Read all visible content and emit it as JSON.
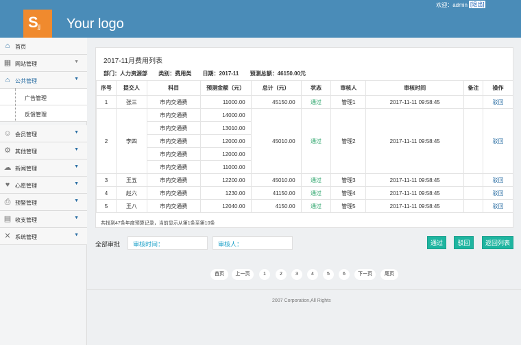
{
  "header": {
    "logo_letter": "S",
    "logo_sub": "jj",
    "logo_text": "Your logo",
    "welcome": "欢迎：admin",
    "logout": "[退出]"
  },
  "sidebar": {
    "items": [
      {
        "label": "首页",
        "icon": "home-icon"
      },
      {
        "label": "网站管理",
        "icon": "grid-icon"
      },
      {
        "label": "公共管理",
        "icon": "home-icon"
      },
      {
        "label": "会员管理",
        "icon": "users-icon"
      },
      {
        "label": "其他管理",
        "icon": "gear-icon"
      },
      {
        "label": "新闻管理",
        "icon": "chat-icon"
      },
      {
        "label": "心愿管理",
        "icon": "heart-icon"
      },
      {
        "label": "预警管理",
        "icon": "printer-icon"
      },
      {
        "label": "收支管理",
        "icon": "card-icon"
      },
      {
        "label": "系统管理",
        "icon": "tools-icon"
      }
    ],
    "subitems": [
      {
        "label": "广告管理"
      },
      {
        "label": "反馈管理"
      }
    ]
  },
  "panel": {
    "title": "2017-11月费用列表",
    "meta": {
      "dept": "部门：人力资源部",
      "category": "类别：费用类",
      "date": "日期：2017-11",
      "total": "预测总额：46150.00元"
    },
    "headers": [
      "序号",
      "提交人",
      "科目",
      "预测金额（元）",
      "总计（元）",
      "状态",
      "审核人",
      "审核时间",
      "备注",
      "操作"
    ],
    "rows": [
      {
        "no": "1",
        "submitter": "张三",
        "subjects": [
          "市内交通费"
        ],
        "amounts": [
          "11000.00"
        ],
        "total": "45150.00",
        "status": "通过",
        "reviewer": "管理1",
        "time": "2017-11-11 09:58:45",
        "note": "",
        "action": "驳回"
      },
      {
        "no": "2",
        "submitter": "李四",
        "subjects": [
          "市内交通费",
          "市内交通费",
          "市内交通费",
          "市内交通费",
          "市内交通费"
        ],
        "amounts": [
          "14000.00",
          "13010.00",
          "12000.00",
          "12000.00",
          "11000.00"
        ],
        "total": "45010.00",
        "status": "通过",
        "reviewer": "管理2",
        "time": "2017-11-11 09:58:45",
        "note": "",
        "action": "驳回"
      },
      {
        "no": "3",
        "submitter": "王五",
        "subjects": [
          "市内交通费"
        ],
        "amounts": [
          "12200.00"
        ],
        "total": "45010.00",
        "status": "通过",
        "reviewer": "管理3",
        "time": "2017-11-11 09:58:45",
        "note": "",
        "action": "驳回"
      },
      {
        "no": "4",
        "submitter": "赵六",
        "subjects": [
          "市内交通费"
        ],
        "amounts": [
          "1230.00"
        ],
        "total": "41150.00",
        "status": "通过",
        "reviewer": "管理4",
        "time": "2017-11-11 09:58:45",
        "note": "",
        "action": "驳回"
      },
      {
        "no": "5",
        "submitter": "王八",
        "subjects": [
          "市内交通费"
        ],
        "amounts": [
          "12040.00"
        ],
        "total": "4150.00",
        "status": "通过",
        "reviewer": "管理5",
        "time": "2017-11-11 09:58:45",
        "note": "",
        "action": "驳回"
      }
    ],
    "footer": "共找到47条年度预算记录，当前显示从第1条至第10条"
  },
  "approval": {
    "label": "全部审批",
    "time_placeholder": "审核时间：",
    "reviewer_placeholder": "审核人：",
    "approve": "通过",
    "reject": "驳回",
    "back": "返回列表"
  },
  "pager": [
    "首页",
    "上一页",
    "1",
    "2",
    "3",
    "4",
    "5",
    "6",
    "下一页",
    "尾页"
  ],
  "copyright": "2007 Corporation,All Rights",
  "colors": {
    "header": "#4a8cb8",
    "logo": "#f08a2e",
    "button": "#1eb5a0",
    "status_green": "#2aa46a",
    "link": "#2a6ea3"
  }
}
